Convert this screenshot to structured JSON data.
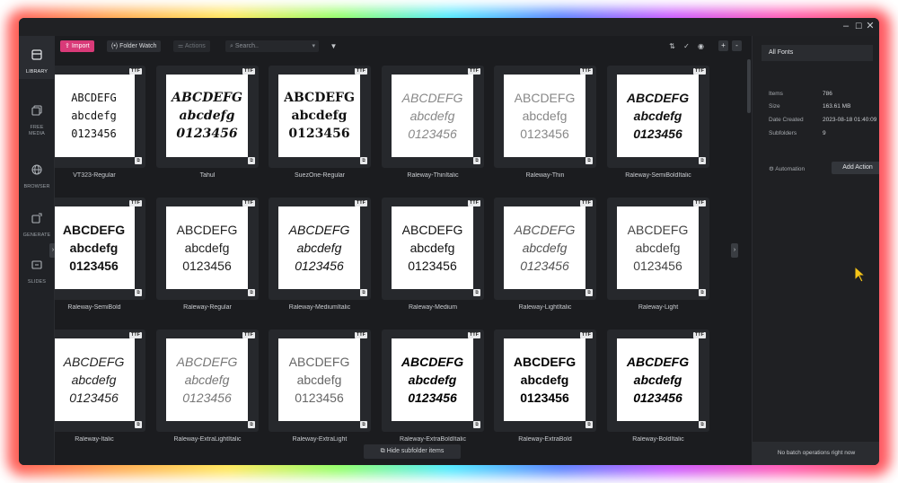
{
  "window": {
    "controls": [
      "–",
      "☐",
      "✕"
    ]
  },
  "sidebar": {
    "items": [
      {
        "label": "LIBRARY",
        "icon": "library-icon"
      },
      {
        "label": "FREE MEDIA",
        "icon": "free-media-icon"
      },
      {
        "label": "BROWSER",
        "icon": "globe-icon"
      },
      {
        "label": "GENERATE",
        "icon": "generate-icon"
      },
      {
        "label": "SLIDES",
        "icon": "slides-icon"
      }
    ]
  },
  "toolbar": {
    "import_label": "Import",
    "folder_watch_label": "Folder Watch",
    "actions_label": "Actions",
    "search_placeholder": "Search..",
    "plus_label": "+",
    "minus_label": "-"
  },
  "preview_lines": [
    "ABCDEFG",
    "abcdefg",
    "0123456"
  ],
  "fonts": [
    {
      "name": "VT323-Regular",
      "badge": "TTF"
    },
    {
      "name": "Tahul",
      "badge": "TTF"
    },
    {
      "name": "SuezOne-Regular",
      "badge": "TTF"
    },
    {
      "name": "Raleway-ThinItalic",
      "badge": "TTF"
    },
    {
      "name": "Raleway-Thin",
      "badge": "TTF"
    },
    {
      "name": "Raleway-SemiBoldItalic",
      "badge": "TTF"
    },
    {
      "name": "Raleway-SemiBold",
      "badge": "TTF"
    },
    {
      "name": "Raleway-Regular",
      "badge": "TTF"
    },
    {
      "name": "Raleway-MediumItalic",
      "badge": "TTF"
    },
    {
      "name": "Raleway-Medium",
      "badge": "TTF"
    },
    {
      "name": "Raleway-LightItalic",
      "badge": "TTF"
    },
    {
      "name": "Raleway-Light",
      "badge": "TTF"
    },
    {
      "name": "Raleway-Italic",
      "badge": "TTF"
    },
    {
      "name": "Raleway-ExtraLightItalic",
      "badge": "TTF"
    },
    {
      "name": "Raleway-ExtraLight",
      "badge": "TTF"
    },
    {
      "name": "Raleway-ExtraBoldItalic",
      "badge": "TTF"
    },
    {
      "name": "Raleway-ExtraBold",
      "badge": "TTF"
    },
    {
      "name": "Raleway-BoldItalic",
      "badge": "TTF"
    }
  ],
  "hide_subfolder_label": "Hide subfolder items",
  "info_panel": {
    "title": "All Fonts",
    "rows": [
      {
        "label": "Items",
        "value": "786"
      },
      {
        "label": "Size",
        "value": "163.61 MB"
      },
      {
        "label": "Date Created",
        "value": "2023-08-18 01:40:09"
      },
      {
        "label": "Subfolders",
        "value": "9"
      }
    ],
    "automation_label": "Automation",
    "add_action_label": "Add Action",
    "footer": "No batch operations right now"
  },
  "colors": {
    "accent": "#d93a78",
    "background": "#1b1c1f",
    "card": "#26282c"
  }
}
